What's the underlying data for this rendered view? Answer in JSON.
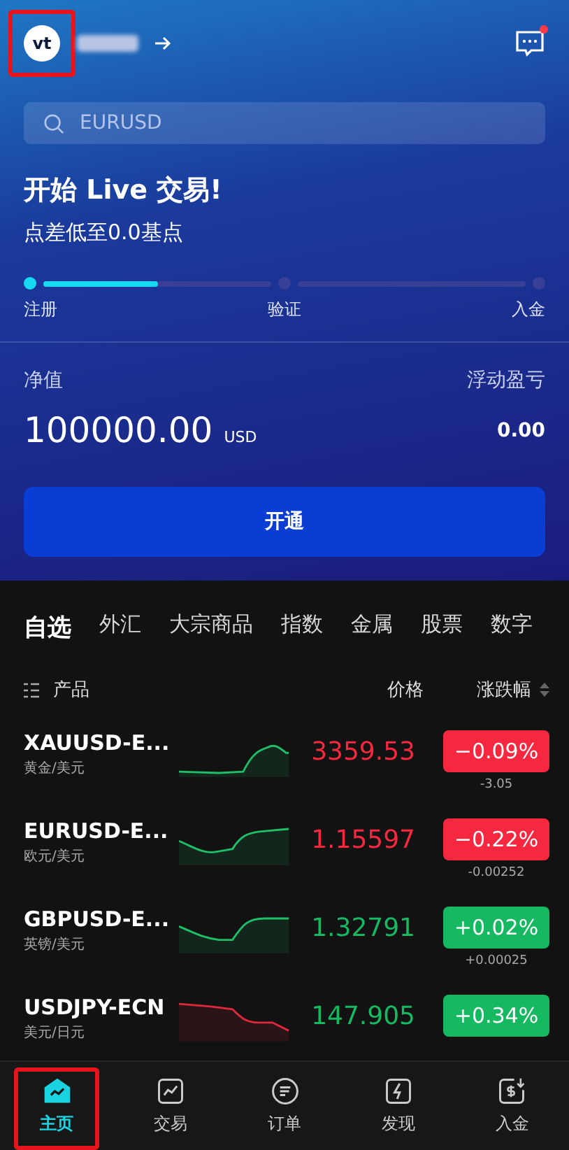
{
  "header": {
    "avatar": {
      "text": "vt",
      "highlighted": true
    },
    "messages": {
      "unread": true
    }
  },
  "search": {
    "placeholder": "EURUSD"
  },
  "promo": {
    "title": "开始 Live 交易!",
    "subtitle": "点差低至0.0基点"
  },
  "progress": {
    "steps": [
      {
        "label": "注册",
        "reached": true
      },
      {
        "label": "验证",
        "reached": false
      },
      {
        "label": "入金",
        "reached": false
      }
    ],
    "segments": [
      {
        "level": 0.5
      },
      {
        "level": 0
      }
    ]
  },
  "account": {
    "equity_label": "净值",
    "equity": "100000.00",
    "currency": "USD",
    "pnl_label": "浮动盈亏",
    "pnl": "0.00",
    "button": "开通"
  },
  "tabs": [
    {
      "label": "自选",
      "selected": true
    },
    {
      "label": "外汇",
      "selected": false
    },
    {
      "label": "大宗商品",
      "selected": false
    },
    {
      "label": "指数",
      "selected": false
    },
    {
      "label": "金属",
      "selected": false
    },
    {
      "label": "股票",
      "selected": false
    },
    {
      "label": "数字",
      "selected": false
    }
  ],
  "table": {
    "columns": [
      "产品",
      "价格",
      "涨跌幅"
    ],
    "rows": [
      {
        "symbol": "XAUUSD-E...",
        "name": "黄金/美元",
        "price": "3359.53",
        "change": "−0.09%",
        "change_amount": "-3.05",
        "rising": false,
        "chart_rising": true
      },
      {
        "symbol": "EURUSD-E...",
        "name": "欧元/美元",
        "price": "1.15597",
        "change": "−0.22%",
        "change_amount": "-0.00252",
        "rising": false,
        "chart_rising": true
      },
      {
        "symbol": "GBPUSD-E...",
        "name": "英镑/美元",
        "price": "1.32791",
        "change": "+0.02%",
        "change_amount": "+0.00025",
        "rising": true,
        "chart_rising": true
      },
      {
        "symbol": "USDJPY-ECN",
        "name": "美元/日元",
        "price": "147.905",
        "change": "+0.34%",
        "rising": true,
        "chart_rising": false
      }
    ]
  },
  "nav": [
    {
      "kind": "home",
      "label": "主页",
      "selected": true,
      "highlighted": true
    },
    {
      "kind": "trade",
      "label": "交易",
      "selected": false,
      "highlighted": false
    },
    {
      "kind": "orders",
      "label": "订单",
      "selected": false,
      "highlighted": false
    },
    {
      "kind": "discover",
      "label": "发现",
      "selected": false,
      "highlighted": false
    },
    {
      "kind": "deposit",
      "label": "入金",
      "selected": false,
      "highlighted": false
    }
  ]
}
